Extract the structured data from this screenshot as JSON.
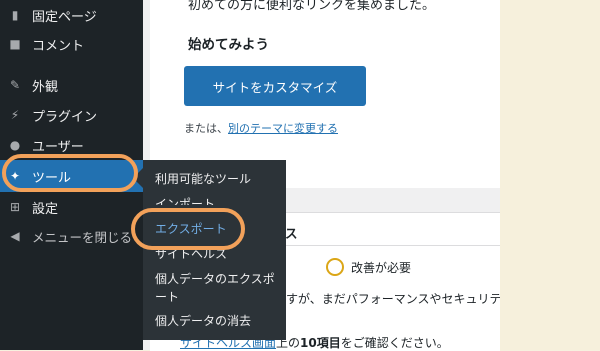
{
  "sidebar": {
    "items": [
      {
        "label": "固定ページ",
        "icon": "page-icon"
      },
      {
        "label": "コメント",
        "icon": "comment-icon"
      },
      {
        "label": "外観",
        "icon": "brush-icon"
      },
      {
        "label": "プラグイン",
        "icon": "plugin-icon"
      },
      {
        "label": "ユーザー",
        "icon": "user-icon"
      },
      {
        "label": "ツール",
        "icon": "wrench-icon"
      },
      {
        "label": "設定",
        "icon": "settings-icon"
      },
      {
        "label": "メニューを閉じる",
        "icon": "collapse-icon"
      }
    ],
    "active": "ツール"
  },
  "flyout": {
    "items": [
      "利用可能なツール",
      "インポート",
      "エクスポート",
      "サイトヘルス",
      "個人データのエクスポート",
      "個人データの消去"
    ]
  },
  "welcome": {
    "cut_text": "初めての方に便利なリンクを集めました。",
    "start_title": "始めてみよう",
    "customize_button": "サイトをカスタマイズ",
    "or_prefix": "または、",
    "change_theme_link": "別のテーマに変更する"
  },
  "site_health": {
    "title_fragment": "ス",
    "status": "改善が必要",
    "description_fragment": "すが、まだパフォーマンスやセキュリティを改",
    "check_link": "サイトヘルス画面",
    "check_suffix": "上の",
    "check_count": "10項目",
    "check_tail": "をご確認ください。"
  },
  "colors": {
    "sidebar": "#1d2327",
    "flyout": "#2c3338",
    "accent": "#2271b1",
    "annotation": "#f2a15a",
    "warning": "#dba617"
  }
}
